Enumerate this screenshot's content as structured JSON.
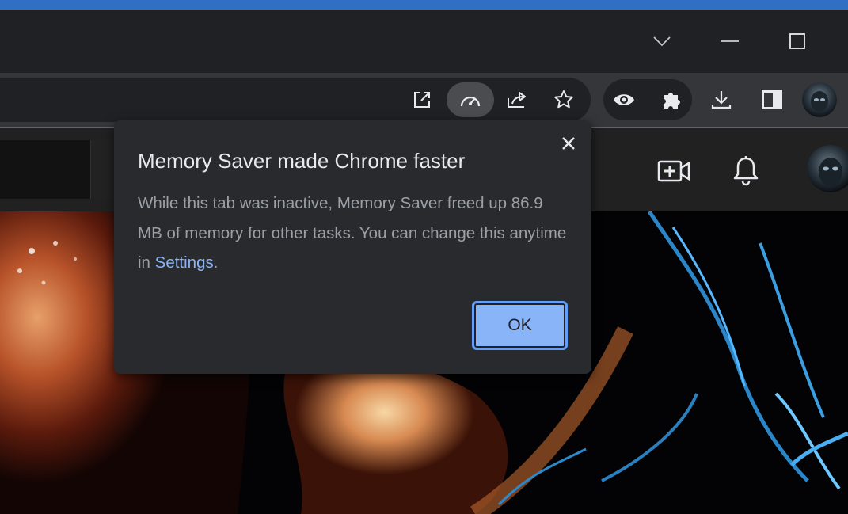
{
  "window": {
    "controls": [
      "tab-search",
      "minimize",
      "maximize"
    ]
  },
  "toolbar": {
    "icons": [
      "open-in-new-icon",
      "memory-saver-icon",
      "share-icon",
      "bookmark-star-icon",
      "eye-icon",
      "extensions-icon",
      "download-icon",
      "side-panel-icon",
      "profile-avatar"
    ]
  },
  "dialog": {
    "title": "Memory Saver made Chrome faster",
    "body_prefix": "While this tab was inactive, Memory Saver freed up 86.9 MB of memory for other tasks. You can change this anytime in ",
    "link_label": "Settings",
    "body_suffix": ".",
    "ok_label": "OK"
  },
  "colors": {
    "accent": "#8ab4f8",
    "dialog_bg": "#292a2d",
    "toolbar_bg": "#35363a",
    "titlebar_bg": "#202124"
  }
}
